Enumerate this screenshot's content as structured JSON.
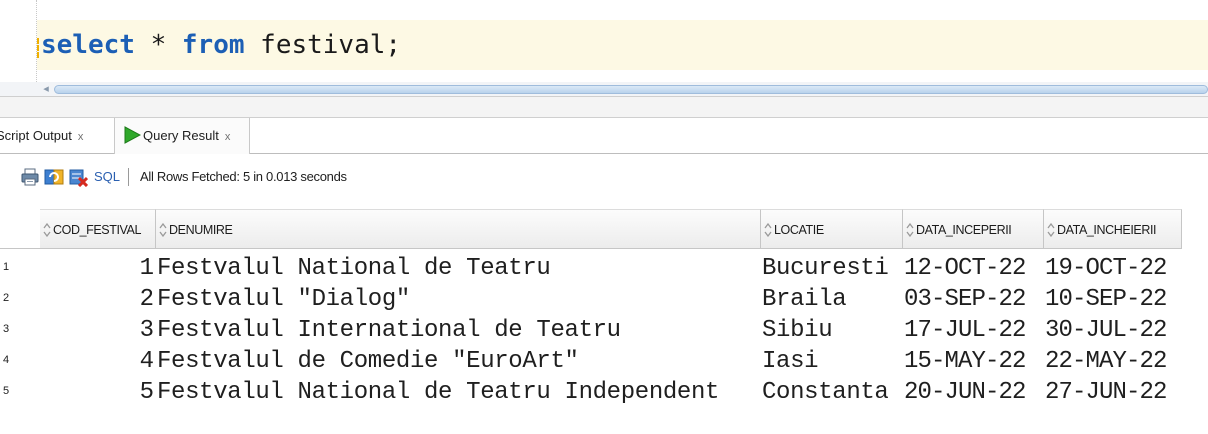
{
  "editor": {
    "keyword_select": "select",
    "star": " * ",
    "keyword_from": "from",
    "rest": " festival;"
  },
  "tabs": [
    {
      "label": "Script Output",
      "close": "x"
    },
    {
      "label": "Query Result",
      "close": "x"
    }
  ],
  "toolbar": {
    "sql_label": "SQL",
    "status": "All Rows Fetched: 5 in 0.013 seconds"
  },
  "grid": {
    "columns": [
      "COD_FESTIVAL",
      "DENUMIRE",
      "LOCATIE",
      "DATA_INCEPERII",
      "DATA_INCHEIERII"
    ],
    "rows": [
      {
        "n": "1",
        "cod": "1",
        "denumire": "Festvalul National de Teatru",
        "locatie": "Bucuresti",
        "inceput": "12-OCT-22",
        "sfarsit": "19-OCT-22"
      },
      {
        "n": "2",
        "cod": "2",
        "denumire": "Festvalul \"Dialog\"",
        "locatie": "Braila",
        "inceput": "03-SEP-22",
        "sfarsit": "10-SEP-22"
      },
      {
        "n": "3",
        "cod": "3",
        "denumire": "Festvalul International de Teatru",
        "locatie": "Sibiu",
        "inceput": "17-JUL-22",
        "sfarsit": "30-JUL-22"
      },
      {
        "n": "4",
        "cod": "4",
        "denumire": "Festvalul de Comedie \"EuroArt\"",
        "locatie": "Iasi",
        "inceput": "15-MAY-22",
        "sfarsit": "22-MAY-22"
      },
      {
        "n": "5",
        "cod": "5",
        "denumire": "Festvalul National de Teatru Independent",
        "locatie": "Constanta",
        "inceput": "20-JUN-22",
        "sfarsit": "27-JUN-22"
      }
    ]
  },
  "colors": {
    "keyword": "#1c5fb5",
    "current_line": "#fdf9e4",
    "play_icon": "#2fa82a"
  }
}
